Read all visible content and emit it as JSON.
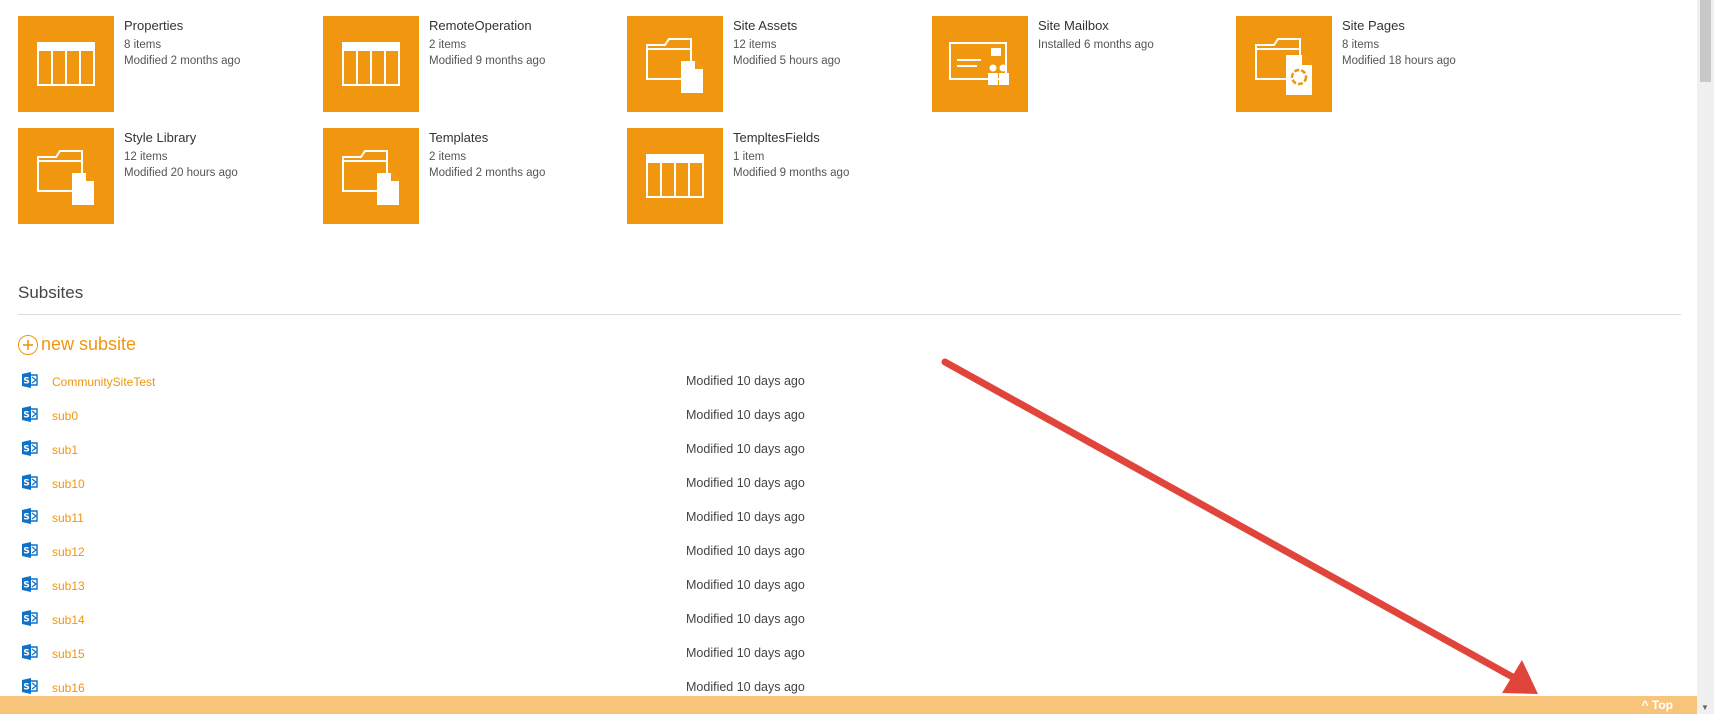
{
  "tiles": [
    {
      "title": "Properties",
      "line1": "8 items",
      "line2": "Modified 2 months ago",
      "icon": "list-icon"
    },
    {
      "title": "RemoteOperation",
      "line1": "2 items",
      "line2": "Modified 9 months ago",
      "icon": "list-icon"
    },
    {
      "title": "Site Assets",
      "line1": "12 items",
      "line2": "Modified 5 hours ago",
      "icon": "folder-doc-icon"
    },
    {
      "title": "Site Mailbox",
      "line1": "Installed 6 months ago",
      "line2": "",
      "icon": "mailbox-icon"
    },
    {
      "title": "Site Pages",
      "line1": "8 items",
      "line2": "Modified 18 hours ago",
      "icon": "folder-page-icon"
    },
    {
      "title": "Style Library",
      "line1": "12 items",
      "line2": "Modified 20 hours ago",
      "icon": "folder-doc-icon"
    },
    {
      "title": "Templates",
      "line1": "2 items",
      "line2": "Modified 2 months ago",
      "icon": "folder-doc-icon"
    },
    {
      "title": "TempltesFields",
      "line1": "1 item",
      "line2": "Modified 9 months ago",
      "icon": "list-icon"
    }
  ],
  "subsites": {
    "heading": "Subsites",
    "new_label": "new subsite",
    "items": [
      {
        "name": "CommunitySiteTest",
        "modified": "Modified 10 days ago"
      },
      {
        "name": "sub0",
        "modified": "Modified 10 days ago"
      },
      {
        "name": "sub1",
        "modified": "Modified 10 days ago"
      },
      {
        "name": "sub10",
        "modified": "Modified 10 days ago"
      },
      {
        "name": "sub11",
        "modified": "Modified 10 days ago"
      },
      {
        "name": "sub12",
        "modified": "Modified 10 days ago"
      },
      {
        "name": "sub13",
        "modified": "Modified 10 days ago"
      },
      {
        "name": "sub14",
        "modified": "Modified 10 days ago"
      },
      {
        "name": "sub15",
        "modified": "Modified 10 days ago"
      },
      {
        "name": "sub16",
        "modified": "Modified 10 days ago"
      }
    ]
  },
  "bottom_bar": {
    "top_label": "^ Top"
  },
  "colors": {
    "accent": "#f0960f",
    "bottom_bar": "#f8c47c",
    "arrow": "#e0443a",
    "sharepoint_blue": "#0f72c9"
  }
}
